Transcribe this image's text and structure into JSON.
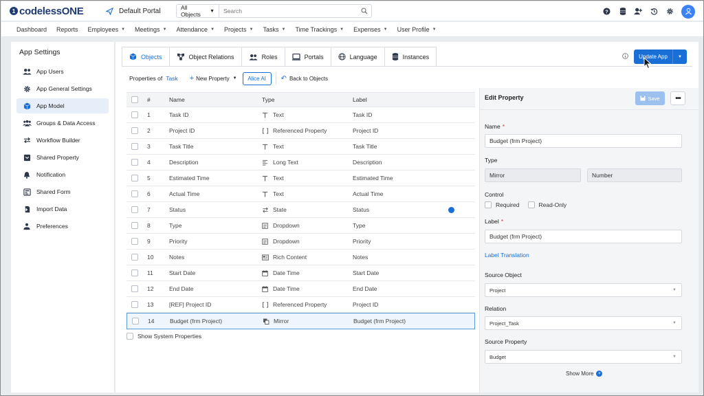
{
  "app": {
    "logo_mark": "1",
    "logo_text": "codelessONE",
    "portal_name": "Default Portal"
  },
  "search": {
    "scope": "All Objects",
    "placeholder": "Search"
  },
  "nav": [
    "Dashboard",
    "Reports",
    "Employees",
    "Meetings",
    "Attendance",
    "Projects",
    "Tasks",
    "Time Trackings",
    "Expenses",
    "User Profile"
  ],
  "nav_has_caret": [
    false,
    false,
    true,
    true,
    true,
    true,
    true,
    true,
    true,
    true
  ],
  "sidebar": {
    "title": "App Settings",
    "items": [
      {
        "label": "App Users",
        "icon": "users-icon"
      },
      {
        "label": "App General Settings",
        "icon": "gear-icon"
      },
      {
        "label": "App Model",
        "icon": "cube-icon",
        "active": true
      },
      {
        "label": "Groups & Data Access",
        "icon": "group-icon"
      },
      {
        "label": "Workflow Builder",
        "icon": "workflow-icon"
      },
      {
        "label": "Shared Property",
        "icon": "shared-property-icon"
      },
      {
        "label": "Notification",
        "icon": "bell-icon"
      },
      {
        "label": "Shared Form",
        "icon": "form-icon"
      },
      {
        "label": "Import Data",
        "icon": "import-icon"
      },
      {
        "label": "Preferences",
        "icon": "preferences-icon"
      }
    ]
  },
  "tabs": [
    {
      "label": "Objects",
      "icon": "cube-icon",
      "active": true
    },
    {
      "label": "Object Relations",
      "icon": "relations-icon"
    },
    {
      "label": "Roles",
      "icon": "roles-icon"
    },
    {
      "label": "Portals",
      "icon": "portal-icon"
    },
    {
      "label": "Language",
      "icon": "globe-icon"
    },
    {
      "label": "Instances",
      "icon": "database-icon"
    }
  ],
  "update_button": "Update App",
  "propbar": {
    "prefix": "Properties of",
    "object": "Task",
    "new_property": "New Property",
    "alice": "Alice AI",
    "back": "Back to Objects"
  },
  "table": {
    "headers": {
      "num": "#",
      "name": "Name",
      "type": "Type",
      "label": "Label"
    },
    "rows": [
      {
        "num": "1",
        "name": "Task ID",
        "type": "Text",
        "type_icon": "text-icon",
        "label": "Task ID"
      },
      {
        "num": "2",
        "name": "Project ID",
        "type": "Referenced Property",
        "type_icon": "brackets-icon",
        "label": "Project ID"
      },
      {
        "num": "3",
        "name": "Task Title",
        "type": "Text",
        "type_icon": "text-icon",
        "label": "Task Title"
      },
      {
        "num": "4",
        "name": "Description",
        "type": "Long Text",
        "type_icon": "long-text-icon",
        "label": "Description"
      },
      {
        "num": "5",
        "name": "Estimated Time",
        "type": "Text",
        "type_icon": "text-icon",
        "label": "Estimated Time"
      },
      {
        "num": "6",
        "name": "Actual Time",
        "type": "Text",
        "type_icon": "text-icon",
        "label": "Actual Time"
      },
      {
        "num": "7",
        "name": "Status",
        "type": "State",
        "type_icon": "state-icon",
        "label": "Status",
        "dot": true
      },
      {
        "num": "8",
        "name": "Type",
        "type": "Dropdown",
        "type_icon": "dropdown-icon",
        "label": "Type"
      },
      {
        "num": "9",
        "name": "Priority",
        "type": "Dropdown",
        "type_icon": "dropdown-icon",
        "label": "Priority"
      },
      {
        "num": "10",
        "name": "Notes",
        "type": "Rich Content",
        "type_icon": "rich-content-icon",
        "label": "Notes"
      },
      {
        "num": "11",
        "name": "Start Date",
        "type": "Date Time",
        "type_icon": "calendar-icon",
        "label": "Start Date"
      },
      {
        "num": "12",
        "name": "End Date",
        "type": "Date Time",
        "type_icon": "calendar-icon",
        "label": "End Date"
      },
      {
        "num": "13",
        "name": "[REF] Project ID",
        "type": "Referenced Property",
        "type_icon": "brackets-icon",
        "label": "Project ID"
      },
      {
        "num": "14",
        "name": "Budget (frm Project)",
        "type": "Mirror",
        "type_icon": "mirror-icon",
        "label": "Budget (frm Project)",
        "selected": true
      }
    ]
  },
  "show_system": "Show System Properties",
  "edit": {
    "title": "Edit Property",
    "save": "Save",
    "name_label": "Name",
    "name_value": "Budget (frm Project)",
    "type_label": "Type",
    "type_value1": "Mirror",
    "type_value2": "Number",
    "control_label": "Control",
    "required": "Required",
    "readonly": "Read-Only",
    "label_label": "Label",
    "label_value": "Budget (frm Project)",
    "label_translation": "Label Translation",
    "source_object_label": "Source Object",
    "source_object_value": "Project",
    "relation_label": "Relation",
    "relation_value": "Project_Task",
    "source_property_label": "Source Property",
    "source_property_value": "Budget",
    "show_more": "Show More"
  },
  "colors": {
    "accent": "#1a6fd6",
    "active_bg": "#e6eef9",
    "brand": "#1f3b72"
  }
}
